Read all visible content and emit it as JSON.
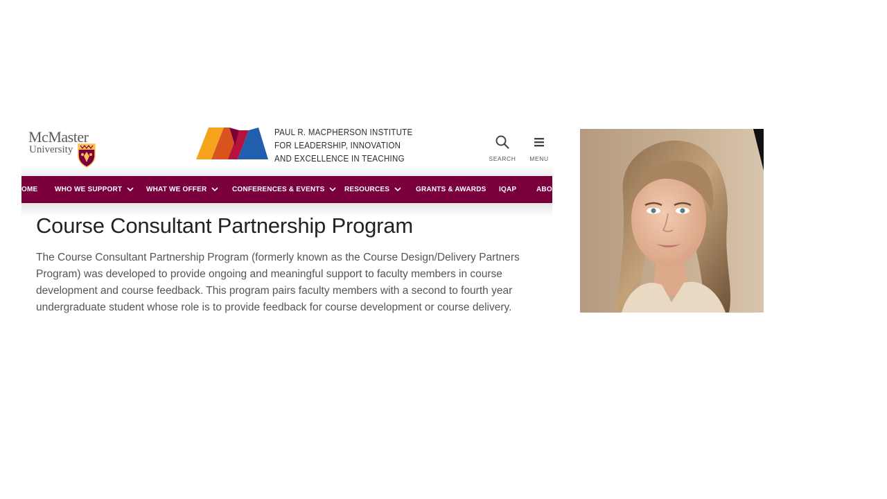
{
  "header": {
    "mcmaster_logo": {
      "line1": "McMaster",
      "line2": "University"
    },
    "institute_lines": [
      "PAUL R. MACPHERSON INSTITUTE",
      "FOR LEADERSHIP, INNOVATION",
      "AND EXCELLENCE IN TEACHING"
    ],
    "search_label": "SEARCH",
    "menu_label": "MENU"
  },
  "nav": {
    "items": [
      {
        "label": "OME",
        "has_dropdown": false
      },
      {
        "label": "WHO WE SUPPORT",
        "has_dropdown": true
      },
      {
        "label": "WHAT WE OFFER",
        "has_dropdown": true
      },
      {
        "label": "CONFERENCES & EVENTS",
        "has_dropdown": true
      },
      {
        "label": "RESOURCES",
        "has_dropdown": true
      },
      {
        "label": "GRANTS & AWARDS",
        "has_dropdown": false
      },
      {
        "label": "IQAP",
        "has_dropdown": false
      },
      {
        "label": "ABOU",
        "has_dropdown": false
      }
    ]
  },
  "page": {
    "title": "Course Consultant Partnership Program",
    "body": "The Course Consultant Partnership Program (formerly known as the Course Design/Delivery Partners Program) was developed to provide ongoing and meaningful support to faculty members in course development and course feedback. This program pairs faculty members with a second to fourth year undergraduate student whose role is to provide feedback for course development or course delivery."
  },
  "colors": {
    "nav_background": "#7a003c",
    "logo_orange": "#f5a21d",
    "logo_red": "#b5123e",
    "logo_maroon": "#7a003c",
    "logo_blue": "#1f5fae"
  },
  "icons": {
    "search": "search-icon",
    "menu": "hamburger-icon",
    "crest": "mcmaster-crest-icon",
    "dropdown": "chevron-down-icon"
  }
}
